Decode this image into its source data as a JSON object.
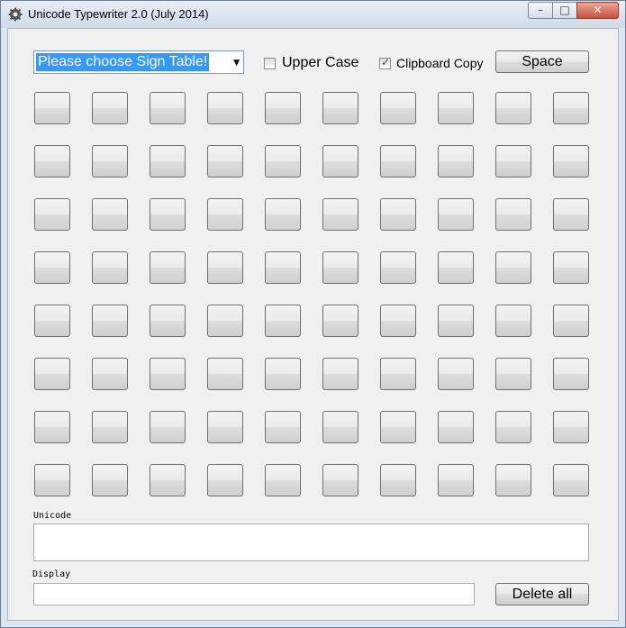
{
  "window": {
    "title": "Unicode Typewriter 2.0 (July 2014)",
    "controls": {
      "minimize": "–",
      "maximize": "□",
      "close": "✕"
    }
  },
  "toolbar": {
    "sign_table_value": "Please choose Sign Table!",
    "upper_case_label": "Upper Case",
    "upper_case_checked": false,
    "clipboard_copy_label": "Clipboard Copy",
    "clipboard_copy_checked": true,
    "space_label": "Space"
  },
  "keyboard": {
    "rows": 8,
    "cols": 10
  },
  "unicode": {
    "label": "Unicode",
    "value": ""
  },
  "display": {
    "label": "Display",
    "value": ""
  },
  "delete_all_label": "Delete all"
}
